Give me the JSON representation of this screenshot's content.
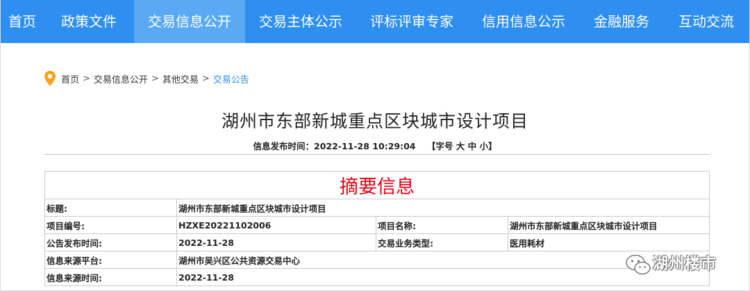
{
  "nav": {
    "items": [
      {
        "label": "首页"
      },
      {
        "label": "政策文件"
      },
      {
        "label": "交易信息公开"
      },
      {
        "label": "交易主体公示"
      },
      {
        "label": "评标评审专家"
      },
      {
        "label": "信用信息公示"
      },
      {
        "label": "金融服务"
      },
      {
        "label": "互动交流"
      }
    ],
    "active_index": 2,
    "bg_color": "#2e8ff0",
    "active_color": "#5aa9f5"
  },
  "breadcrumb": {
    "icon": "location-pin-icon",
    "items": [
      "首页",
      "交易信息公开",
      "其他交易",
      "交易公告"
    ],
    "separator": ">"
  },
  "article": {
    "title": "湖州市东部新城重点区块城市设计项目",
    "publish_label": "信息发布时间：",
    "publish_time": "2022-11-28 10:29:04",
    "font_size_label": "【字号",
    "font_large": "大",
    "font_medium": "中",
    "font_small": "小】"
  },
  "summary": {
    "heading": "摘要信息",
    "heading_color": "#e60012",
    "title_label": "标题:",
    "title_value": "湖州市东部新城重点区块城市设计项目",
    "rows": [
      {
        "l1": "项目编号:",
        "v1": "HZXE20221102006",
        "l2": "项目名称:",
        "v2": "湖州市东部新城重点区块城市设计项目"
      },
      {
        "l1": "公告发布时间:",
        "v1": "2022-11-28",
        "l2": "交易业务类型:",
        "v2": "医用耗材"
      }
    ],
    "platform_label": "信息来源平台:",
    "platform_value": "湖州市吴兴区公共资源交易中心",
    "source_time_label": "信息来源时间:",
    "source_time_value": "2022-11-28"
  },
  "watermark": {
    "text": "湖州楼市",
    "icon": "wechat-icon"
  }
}
